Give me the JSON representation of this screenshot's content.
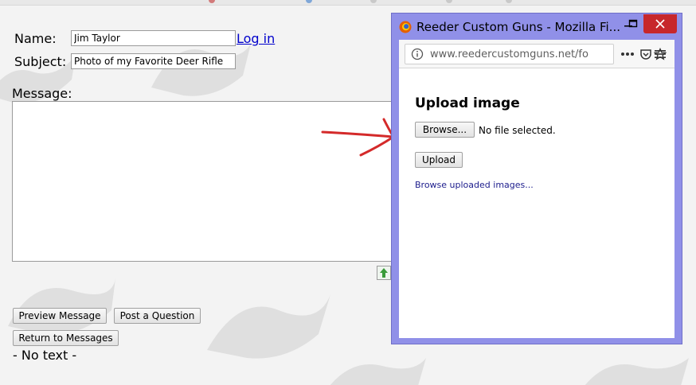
{
  "form": {
    "name_label": "Name:",
    "name_value": "Jim Taylor",
    "login_link": "Log in",
    "subject_label": "Subject:",
    "subject_value": "Photo of my Favorite Deer Rifle",
    "message_label": "Message:",
    "message_value": "",
    "preview_button": "Preview Message",
    "post_button": "Post a Question",
    "return_button": "Return to Messages",
    "no_text": "- No text -"
  },
  "popup": {
    "window_title": "Reeder Custom Guns - Mozilla Fi...",
    "url": "www.reedercustomguns.net/fo",
    "heading": "Upload image",
    "browse_button": "Browse...",
    "file_status": "No file selected.",
    "upload_button": "Upload",
    "browse_uploaded_link": "Browse uploaded images..."
  },
  "colors": {
    "window_frame": "#9090e8",
    "close_button": "#c7272c",
    "annotation_arrow": "#d42a2a",
    "link": "#0000cc"
  },
  "icons": [
    "firefox-icon",
    "info-icon",
    "more-dots-icon",
    "pocket-icon",
    "bookmark-star-icon",
    "hamburger-menu-icon",
    "minimize-icon",
    "maximize-icon",
    "close-icon",
    "green-arrow-icon"
  ]
}
